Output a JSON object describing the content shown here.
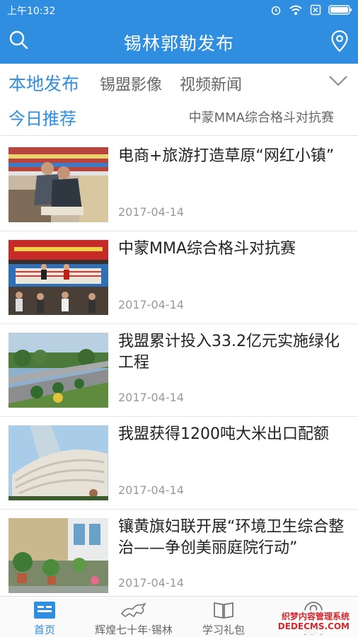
{
  "status_bar": {
    "time": "上午10:32"
  },
  "header": {
    "title": "锡林郭勒发布",
    "search_icon": "search-icon",
    "location_icon": "location-pin-icon"
  },
  "tabs": [
    {
      "label": "本地发布"
    },
    {
      "label": "锡盟影像"
    },
    {
      "label": "视频新闻"
    }
  ],
  "sub_tabs": {
    "active": "今日推荐",
    "right": "中蒙MMA综合格斗对抗赛"
  },
  "news": [
    {
      "title": "电商+旅游打造草原“网红小镇”",
      "date": "2017-04-14"
    },
    {
      "title": "中蒙MMA综合格斗对抗赛",
      "date": "2017-04-14"
    },
    {
      "title": "我盟累计投入33.2亿元实施绿化工程",
      "date": "2017-04-14"
    },
    {
      "title": "我盟获得1200吨大米出口配额",
      "date": "2017-04-14"
    },
    {
      "title": "镶黄旗妇联开展“环境卫生综合整治——争创美丽庭院行动”",
      "date": "2017-04-14"
    }
  ],
  "bottom_nav": [
    {
      "label": "首页",
      "icon": "home-icon"
    },
    {
      "label": "辉煌七十年·锡林",
      "icon": "horse-icon"
    },
    {
      "label": "学习礼包",
      "icon": "book-icon"
    },
    {
      "label": "我的",
      "icon": "profile-icon"
    }
  ],
  "watermark": {
    "line1": "织梦内容管理系统",
    "line2": "DEDECMS.COM"
  },
  "colors": {
    "accent": "#2f8ee0",
    "text": "#222222",
    "muted": "#999999"
  }
}
